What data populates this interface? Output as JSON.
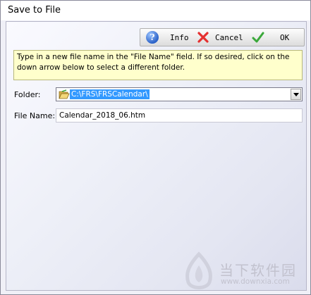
{
  "window": {
    "title": "Save to File"
  },
  "toolbar": {
    "info_label": "Info",
    "cancel_label": "Cancel",
    "ok_label": "OK",
    "info_icon": "info-icon",
    "cancel_icon": "red-x-icon",
    "ok_icon": "green-check-icon"
  },
  "hint": {
    "text": "Type in a new file name in the \"File Name\" field. If so desired, click on the down arrow below to select a different folder."
  },
  "form": {
    "folder_label": "Folder:",
    "folder_value": "C:\\FRS\\FRSCalendar\\",
    "file_name_label": "File Name:",
    "file_name_value": "Calendar_2018_06.htm"
  },
  "watermark": {
    "text": "当下软件园",
    "url": "www.downxia.com"
  },
  "colors": {
    "selection": "#3399ff",
    "hint_background": "#ffffcc",
    "ok_check": "#3aa83a",
    "cancel_x": "#e53030"
  }
}
